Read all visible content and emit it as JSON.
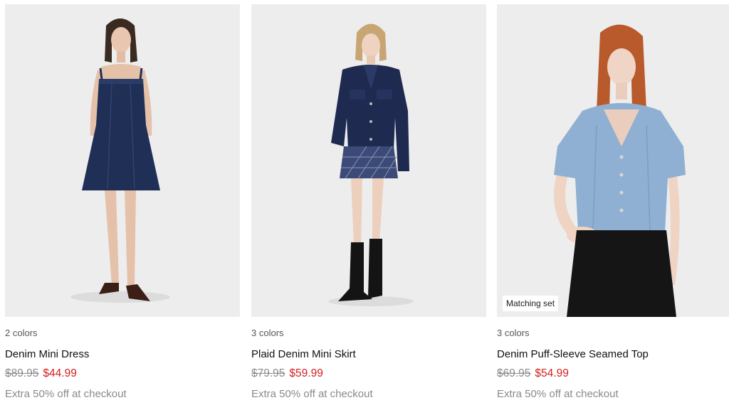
{
  "products": [
    {
      "colors": "2 colors",
      "name": "Denim Mini Dress",
      "price_original": "$89.95",
      "price_sale": "$44.99",
      "promo": "Extra 50% off at checkout"
    },
    {
      "colors": "3 colors",
      "name": "Plaid Denim Mini Skirt",
      "price_original": "$79.95",
      "price_sale": "$59.99",
      "promo": "Extra 50% off at checkout"
    },
    {
      "colors": "3 colors",
      "name": "Denim Puff-Sleeve Seamed Top",
      "price_original": "$69.95",
      "price_sale": "$54.99",
      "promo": "Extra 50% off at checkout",
      "badge": "Matching set"
    }
  ],
  "colors": {
    "sale_price": "#d32020",
    "original_price": "#8a8a8a",
    "photo_background": "#ededed"
  }
}
